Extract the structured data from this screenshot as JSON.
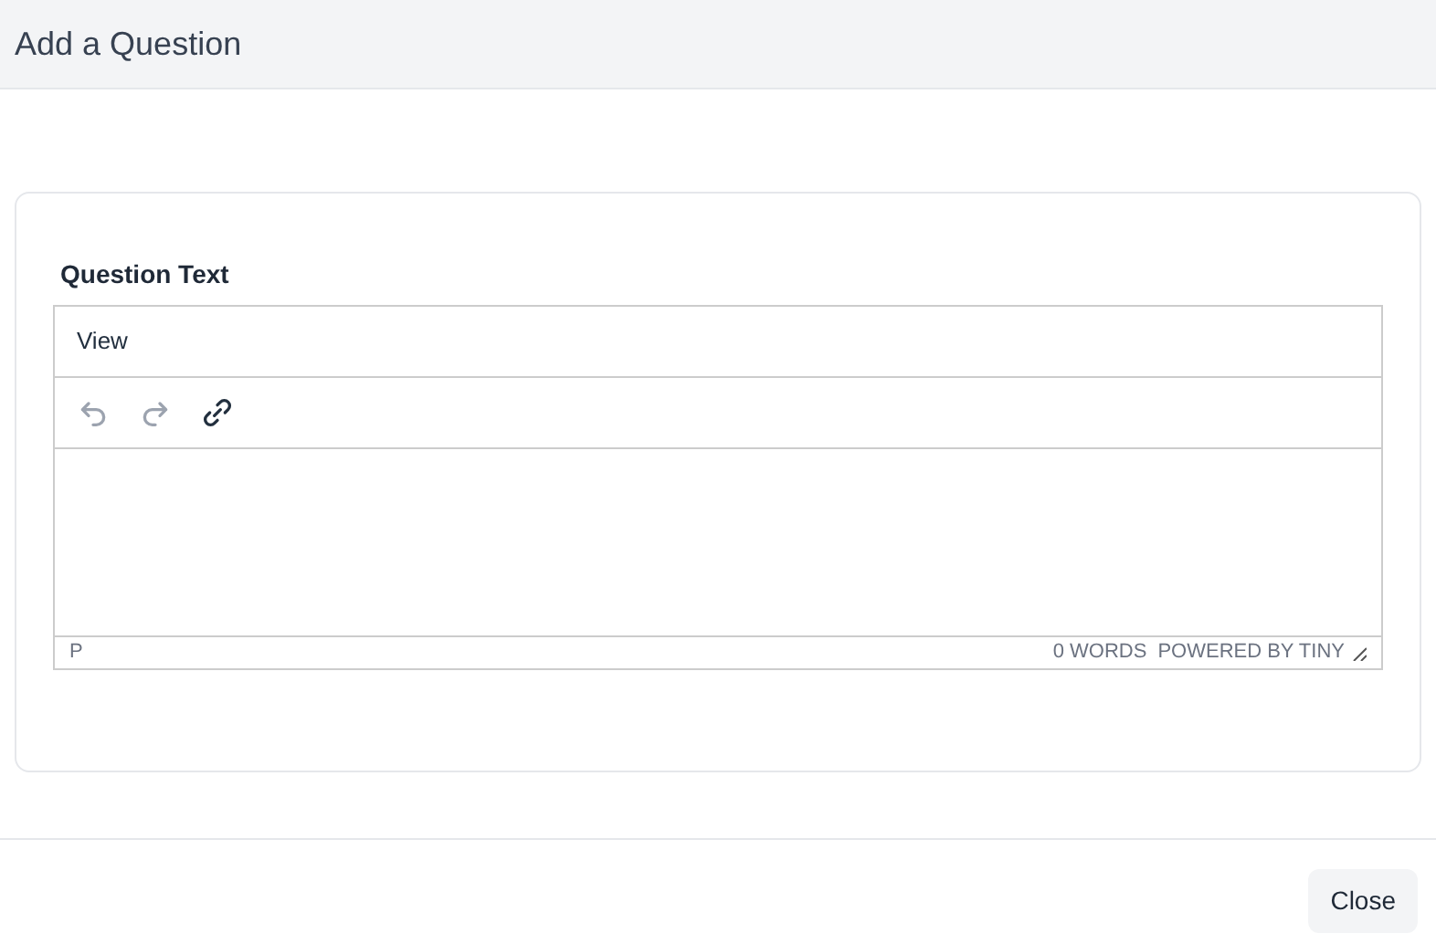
{
  "dialog": {
    "title": "Add a Question"
  },
  "field": {
    "label": "Question Text"
  },
  "editor": {
    "menu": [
      "View"
    ],
    "toolbar": [
      {
        "kind": "undo",
        "disabled": true
      },
      {
        "kind": "redo",
        "disabled": true
      },
      {
        "kind": "link",
        "disabled": false
      }
    ],
    "status": {
      "path": "P",
      "word_count": "0 WORDS",
      "branding": "POWERED BY TINY"
    }
  },
  "buttons": [
    "Close"
  ]
}
